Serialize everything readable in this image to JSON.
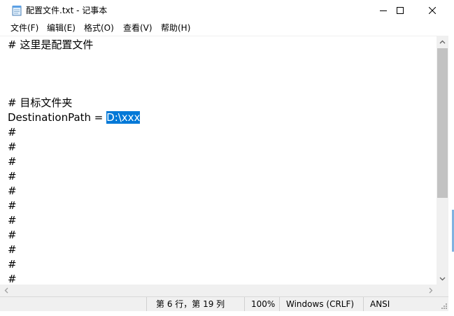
{
  "window": {
    "title": "配置文件.txt - 记事本",
    "app_icon": "notepad-icon"
  },
  "controls": {
    "minimize_icon": "minimize-icon",
    "maximize_icon": "maximize-icon",
    "close_icon": "close-icon"
  },
  "menu": {
    "items": [
      {
        "label": "文件(F)"
      },
      {
        "label": "编辑(E)"
      },
      {
        "label": "格式(O)"
      },
      {
        "label": "查看(V)"
      },
      {
        "label": "帮助(H)"
      }
    ]
  },
  "editor": {
    "lines": [
      "# 这里是配置文件",
      "",
      "",
      "",
      "# 目标文件夹",
      "DestinationPath = ",
      "#",
      "#",
      "#",
      "#",
      "#",
      "#",
      "#",
      "#",
      "#",
      "#",
      "#"
    ],
    "selected_text": "D:\\xxx"
  },
  "statusbar": {
    "position": "第 6 行，第 19 列",
    "zoom": "100%",
    "line_ending": "Windows (CRLF)",
    "encoding": "ANSI"
  },
  "colors": {
    "selection": "#0078d7",
    "chrome": "#f0f0f0",
    "scroll_thumb": "#c2c2c2"
  }
}
